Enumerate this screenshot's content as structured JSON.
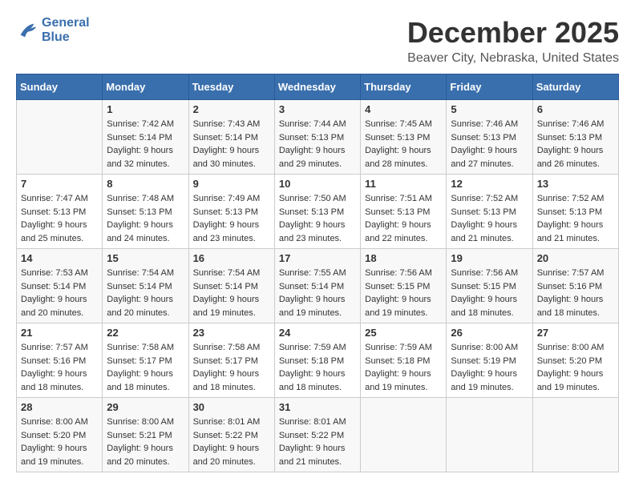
{
  "header": {
    "logo_line1": "General",
    "logo_line2": "Blue",
    "month": "December 2025",
    "location": "Beaver City, Nebraska, United States"
  },
  "days_of_week": [
    "Sunday",
    "Monday",
    "Tuesday",
    "Wednesday",
    "Thursday",
    "Friday",
    "Saturday"
  ],
  "weeks": [
    [
      {
        "day": "",
        "info": ""
      },
      {
        "day": "1",
        "info": "Sunrise: 7:42 AM\nSunset: 5:14 PM\nDaylight: 9 hours\nand 32 minutes."
      },
      {
        "day": "2",
        "info": "Sunrise: 7:43 AM\nSunset: 5:14 PM\nDaylight: 9 hours\nand 30 minutes."
      },
      {
        "day": "3",
        "info": "Sunrise: 7:44 AM\nSunset: 5:13 PM\nDaylight: 9 hours\nand 29 minutes."
      },
      {
        "day": "4",
        "info": "Sunrise: 7:45 AM\nSunset: 5:13 PM\nDaylight: 9 hours\nand 28 minutes."
      },
      {
        "day": "5",
        "info": "Sunrise: 7:46 AM\nSunset: 5:13 PM\nDaylight: 9 hours\nand 27 minutes."
      },
      {
        "day": "6",
        "info": "Sunrise: 7:46 AM\nSunset: 5:13 PM\nDaylight: 9 hours\nand 26 minutes."
      }
    ],
    [
      {
        "day": "7",
        "info": "Sunrise: 7:47 AM\nSunset: 5:13 PM\nDaylight: 9 hours\nand 25 minutes."
      },
      {
        "day": "8",
        "info": "Sunrise: 7:48 AM\nSunset: 5:13 PM\nDaylight: 9 hours\nand 24 minutes."
      },
      {
        "day": "9",
        "info": "Sunrise: 7:49 AM\nSunset: 5:13 PM\nDaylight: 9 hours\nand 23 minutes."
      },
      {
        "day": "10",
        "info": "Sunrise: 7:50 AM\nSunset: 5:13 PM\nDaylight: 9 hours\nand 23 minutes."
      },
      {
        "day": "11",
        "info": "Sunrise: 7:51 AM\nSunset: 5:13 PM\nDaylight: 9 hours\nand 22 minutes."
      },
      {
        "day": "12",
        "info": "Sunrise: 7:52 AM\nSunset: 5:13 PM\nDaylight: 9 hours\nand 21 minutes."
      },
      {
        "day": "13",
        "info": "Sunrise: 7:52 AM\nSunset: 5:13 PM\nDaylight: 9 hours\nand 21 minutes."
      }
    ],
    [
      {
        "day": "14",
        "info": "Sunrise: 7:53 AM\nSunset: 5:14 PM\nDaylight: 9 hours\nand 20 minutes."
      },
      {
        "day": "15",
        "info": "Sunrise: 7:54 AM\nSunset: 5:14 PM\nDaylight: 9 hours\nand 20 minutes."
      },
      {
        "day": "16",
        "info": "Sunrise: 7:54 AM\nSunset: 5:14 PM\nDaylight: 9 hours\nand 19 minutes."
      },
      {
        "day": "17",
        "info": "Sunrise: 7:55 AM\nSunset: 5:14 PM\nDaylight: 9 hours\nand 19 minutes."
      },
      {
        "day": "18",
        "info": "Sunrise: 7:56 AM\nSunset: 5:15 PM\nDaylight: 9 hours\nand 19 minutes."
      },
      {
        "day": "19",
        "info": "Sunrise: 7:56 AM\nSunset: 5:15 PM\nDaylight: 9 hours\nand 18 minutes."
      },
      {
        "day": "20",
        "info": "Sunrise: 7:57 AM\nSunset: 5:16 PM\nDaylight: 9 hours\nand 18 minutes."
      }
    ],
    [
      {
        "day": "21",
        "info": "Sunrise: 7:57 AM\nSunset: 5:16 PM\nDaylight: 9 hours\nand 18 minutes."
      },
      {
        "day": "22",
        "info": "Sunrise: 7:58 AM\nSunset: 5:17 PM\nDaylight: 9 hours\nand 18 minutes."
      },
      {
        "day": "23",
        "info": "Sunrise: 7:58 AM\nSunset: 5:17 PM\nDaylight: 9 hours\nand 18 minutes."
      },
      {
        "day": "24",
        "info": "Sunrise: 7:59 AM\nSunset: 5:18 PM\nDaylight: 9 hours\nand 18 minutes."
      },
      {
        "day": "25",
        "info": "Sunrise: 7:59 AM\nSunset: 5:18 PM\nDaylight: 9 hours\nand 19 minutes."
      },
      {
        "day": "26",
        "info": "Sunrise: 8:00 AM\nSunset: 5:19 PM\nDaylight: 9 hours\nand 19 minutes."
      },
      {
        "day": "27",
        "info": "Sunrise: 8:00 AM\nSunset: 5:20 PM\nDaylight: 9 hours\nand 19 minutes."
      }
    ],
    [
      {
        "day": "28",
        "info": "Sunrise: 8:00 AM\nSunset: 5:20 PM\nDaylight: 9 hours\nand 19 minutes."
      },
      {
        "day": "29",
        "info": "Sunrise: 8:00 AM\nSunset: 5:21 PM\nDaylight: 9 hours\nand 20 minutes."
      },
      {
        "day": "30",
        "info": "Sunrise: 8:01 AM\nSunset: 5:22 PM\nDaylight: 9 hours\nand 20 minutes."
      },
      {
        "day": "31",
        "info": "Sunrise: 8:01 AM\nSunset: 5:22 PM\nDaylight: 9 hours\nand 21 minutes."
      },
      {
        "day": "",
        "info": ""
      },
      {
        "day": "",
        "info": ""
      },
      {
        "day": "",
        "info": ""
      }
    ]
  ]
}
